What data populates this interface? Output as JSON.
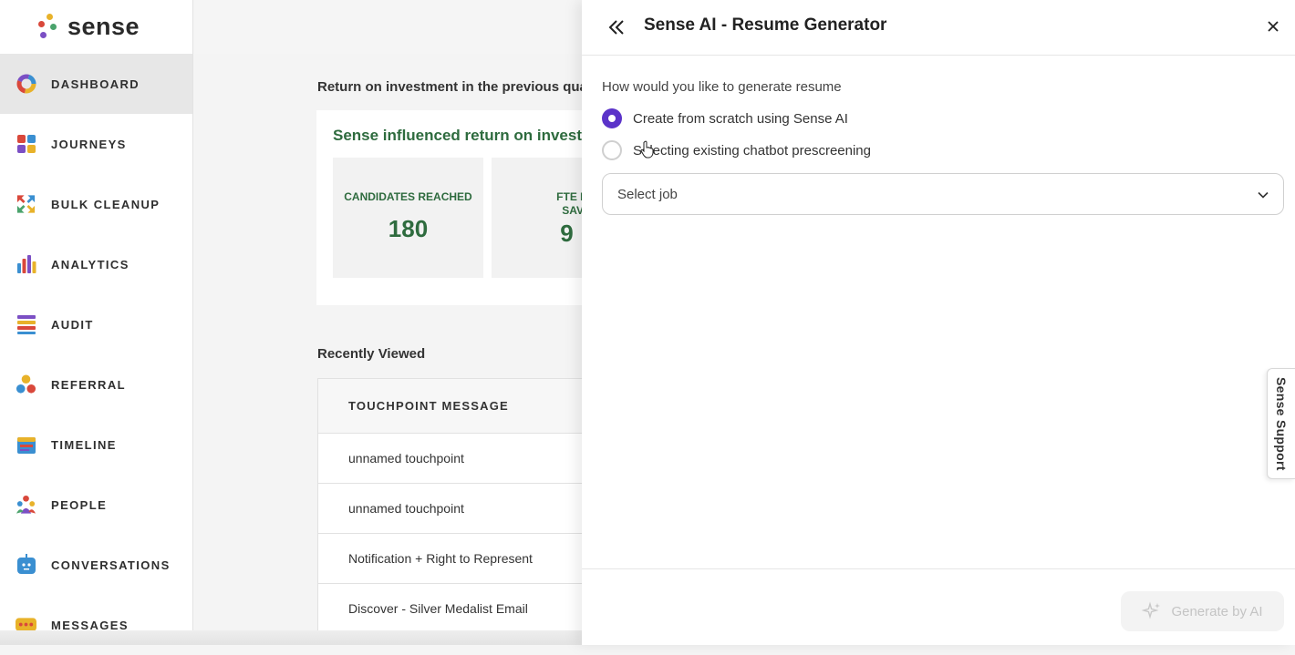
{
  "brand": {
    "name": "sense"
  },
  "sidebar": {
    "items": [
      {
        "label": "DASHBOARD",
        "icon": "dashboard-icon",
        "active": true
      },
      {
        "label": "JOURNEYS",
        "icon": "journeys-icon"
      },
      {
        "label": "BULK CLEANUP",
        "icon": "bulk-cleanup-icon"
      },
      {
        "label": "ANALYTICS",
        "icon": "analytics-icon"
      },
      {
        "label": "AUDIT",
        "icon": "audit-icon"
      },
      {
        "label": "REFERRAL",
        "icon": "referral-icon"
      },
      {
        "label": "TIMELINE",
        "icon": "timeline-icon"
      },
      {
        "label": "PEOPLE",
        "icon": "people-icon"
      },
      {
        "label": "CONVERSATIONS",
        "icon": "conversations-icon"
      },
      {
        "label": "MESSAGES",
        "icon": "messages-icon"
      }
    ]
  },
  "main": {
    "roi_title": "Return on investment in the previous quar",
    "roi_heading": "Sense influenced return on investr",
    "stats": [
      {
        "label": "CANDIDATES REACHED",
        "value": "180"
      },
      {
        "label": "FTE HOU\nSAVED",
        "value": "9"
      }
    ],
    "recent_title": "Recently Viewed",
    "table": {
      "header": "TOUCHPOINT MESSAGE",
      "rows": [
        "unnamed touchpoint",
        "unnamed touchpoint",
        "Notification + Right to Represent",
        "Discover - Silver Medalist Email"
      ]
    }
  },
  "drawer": {
    "title": "Sense AI - Resume Generator",
    "question": "How would you like to generate resume",
    "options": [
      {
        "label": "Create from scratch using Sense AI",
        "selected": true
      },
      {
        "label": "Selecting existing chatbot prescreening",
        "selected": false
      }
    ],
    "select": {
      "value": "Select job"
    },
    "generate_label": "Generate by AI"
  },
  "support": {
    "label": "Sense Support"
  },
  "colors": {
    "accent": "#5b33c9",
    "roi_green": "#2e6b3e"
  }
}
